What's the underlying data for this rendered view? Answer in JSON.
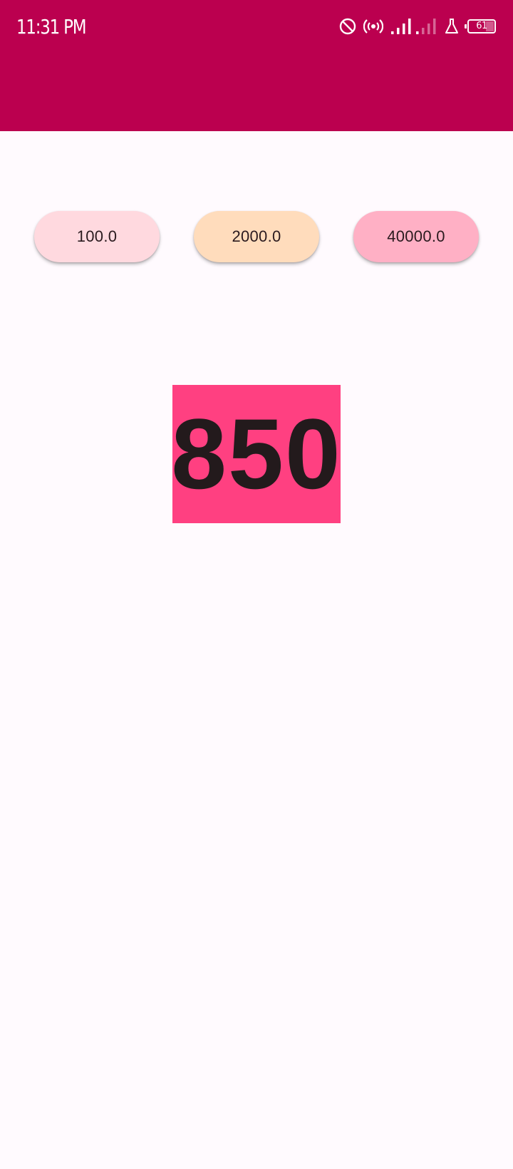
{
  "status_bar": {
    "time": "11:31 PM",
    "battery_level": "61",
    "background_color": "#bb004f",
    "icons": [
      "do-not-disturb-icon",
      "hotspot-icon",
      "signal-strength-icon",
      "signal-strength-secondary-icon",
      "lab-flask-icon",
      "battery-icon"
    ]
  },
  "buttons": [
    {
      "label": "100.0",
      "color": "#ffd9df"
    },
    {
      "label": "2000.0",
      "color": "#ffdcbc"
    },
    {
      "label": "40000.0",
      "color": "#ffb0c5"
    }
  ],
  "counter": {
    "value": "850",
    "background_color": "#ff4081"
  },
  "page_background": "#fffafe"
}
